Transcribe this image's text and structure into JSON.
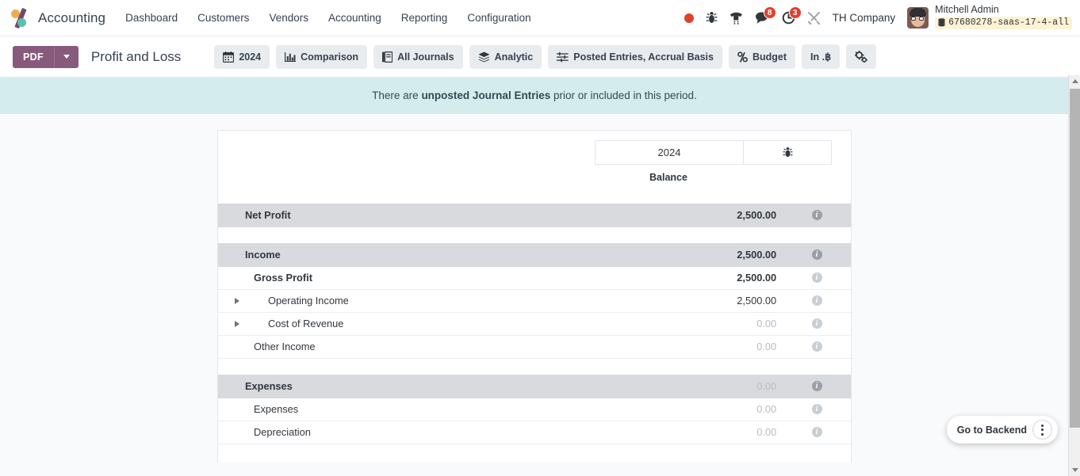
{
  "navbar": {
    "brand": "Accounting",
    "logo_icon": "odoo-logo-icon",
    "menu": [
      {
        "label": "Dashboard"
      },
      {
        "label": "Customers"
      },
      {
        "label": "Vendors"
      },
      {
        "label": "Accounting"
      },
      {
        "label": "Reporting"
      },
      {
        "label": "Configuration"
      }
    ],
    "sys_icons": [
      {
        "name": "recording-dot-icon",
        "badge": null
      },
      {
        "name": "bug-icon",
        "badge": null
      },
      {
        "name": "phone-dialpad-icon",
        "badge": null
      },
      {
        "name": "chat-messages-icon",
        "badge": "8"
      },
      {
        "name": "activity-clock-icon",
        "badge": "3"
      },
      {
        "name": "tools-wrench-icon",
        "badge": null
      }
    ],
    "company": "TH Company",
    "user_name": "Mitchell Admin",
    "database": "67680278-saas-17-4-all",
    "database_icon": "database-icon",
    "avatar_icon": "user-avatar"
  },
  "control_panel": {
    "pdf_label": "PDF",
    "pdf_caret_icon": "chevron-down-icon",
    "report_title": "Profit and Loss",
    "buttons": [
      {
        "label": "2024",
        "icon": "calendar-icon"
      },
      {
        "label": "Comparison",
        "icon": "bar-chart-icon"
      },
      {
        "label": "All Journals",
        "icon": "book-icon"
      },
      {
        "label": "Analytic",
        "icon": "layers-icon"
      },
      {
        "label": "Posted Entries, Accrual Basis",
        "icon": "sliders-icon"
      },
      {
        "label": "Budget",
        "icon": "percent-icon"
      },
      {
        "label": "In .฿",
        "icon": null
      },
      {
        "label": "",
        "icon": "gear-cogs-icon"
      }
    ]
  },
  "alert": {
    "prefix": "There are ",
    "bold": "unposted Journal Entries",
    "suffix": " prior or included in this period."
  },
  "report": {
    "header": {
      "period_label": "2024",
      "debug_icon": "bug-icon",
      "balance_label": "Balance"
    },
    "rows": [
      {
        "label": "Net Profit",
        "value": "2,500.00",
        "level": 0,
        "expandable": false,
        "zero": false,
        "bold": true,
        "group": 1
      },
      {
        "label": "Income",
        "value": "2,500.00",
        "level": 0,
        "expandable": false,
        "zero": false,
        "bold": true,
        "group": 2
      },
      {
        "label": "Gross Profit",
        "value": "2,500.00",
        "level": 1,
        "expandable": false,
        "zero": false,
        "bold": true,
        "group": 2
      },
      {
        "label": "Operating Income",
        "value": "2,500.00",
        "level": 2,
        "expandable": true,
        "zero": false,
        "bold": false,
        "group": 2
      },
      {
        "label": "Cost of Revenue",
        "value": "0.00",
        "level": 2,
        "expandable": true,
        "zero": true,
        "bold": false,
        "group": 2
      },
      {
        "label": "Other Income",
        "value": "0.00",
        "level": 3,
        "expandable": false,
        "zero": true,
        "bold": false,
        "group": 2
      },
      {
        "label": "Expenses",
        "value": "0.00",
        "level": 0,
        "expandable": false,
        "zero": true,
        "bold": true,
        "group": 3
      },
      {
        "label": "Expenses",
        "value": "0.00",
        "level": 3,
        "expandable": false,
        "zero": true,
        "bold": false,
        "group": 3
      },
      {
        "label": "Depreciation",
        "value": "0.00",
        "level": 3,
        "expandable": false,
        "zero": true,
        "bold": false,
        "group": 3
      }
    ]
  },
  "backend_widget": {
    "label": "Go to Backend",
    "menu_icon": "kebab-menu-icon"
  },
  "colors": {
    "brand_purple": "#875a7b",
    "alert_bg": "#d5ecef",
    "badge_red": "#e2402c",
    "row_header_bg": "#d8dadd"
  }
}
